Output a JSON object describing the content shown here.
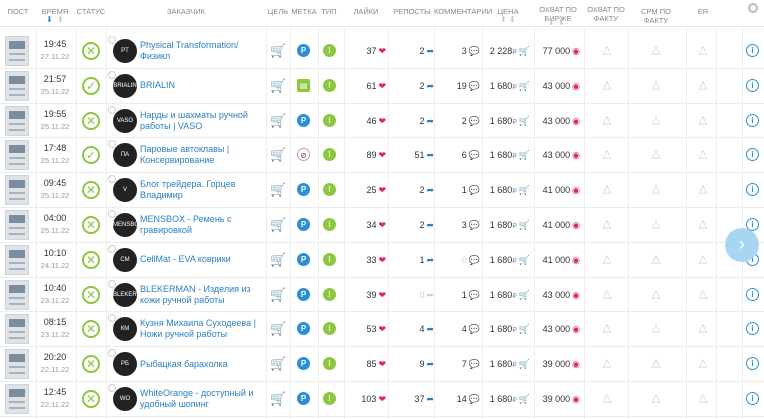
{
  "columns": {
    "post": "ПОСТ",
    "time": "ВРЕМЯ",
    "status": "СТАТУС",
    "channel": "ЗАКАЗЧИК",
    "goal": "ЦЕЛЬ",
    "mark": "МЕТКА",
    "type": "ТИП",
    "likes": "ЛАЙКИ",
    "reposts": "РЕПОСТЫ",
    "comments": "КОММЕНТАРИИ",
    "price": "ЦЕНА",
    "reach_exchange": "ОХВАТ ПО БИРЖЕ",
    "reach_fact": "ОХВАТ ПО ФАКТУ",
    "cpm_fact": "CPM ПО ФАКТУ",
    "er": "ER"
  },
  "rows": [
    {
      "time": "19:45",
      "date": "27.11.22",
      "status": "fail",
      "channel": "Physical Transformation/ Физикл",
      "mark": "p",
      "likes": "37",
      "reposts": "2",
      "comments": "3",
      "comments_faded": false,
      "reposts_faded": false,
      "price": "2 228",
      "reach": "77 000",
      "avatar": "PT"
    },
    {
      "time": "21:57",
      "date": "25.11.22",
      "status": "ok",
      "channel": "BRIALIN",
      "mark": "book",
      "likes": "61",
      "reposts": "2",
      "comments": "19",
      "comments_faded": false,
      "reposts_faded": false,
      "price": "1 680",
      "reach": "43 000",
      "avatar": "BRIALIN"
    },
    {
      "time": "19:55",
      "date": "25.11.22",
      "status": "fail",
      "channel": "Нарды и шахматы ручной работы | VASO",
      "mark": "p",
      "likes": "46",
      "reposts": "2",
      "comments": "2",
      "comments_faded": false,
      "reposts_faded": false,
      "price": "1 680",
      "reach": "43 000",
      "avatar": "VASO"
    },
    {
      "time": "17:48",
      "date": "25.11.22",
      "status": "ok",
      "channel": "Паровые автоклавы | Консервирование",
      "mark": "no",
      "likes": "89",
      "reposts": "51",
      "comments": "6",
      "comments_faded": false,
      "reposts_faded": false,
      "price": "1 680",
      "reach": "43 000",
      "avatar": "ПА"
    },
    {
      "time": "09:45",
      "date": "25.11.22",
      "status": "fail",
      "channel": "Блог трейдера. Горцев Владимир",
      "mark": "p",
      "likes": "25",
      "reposts": "2",
      "comments": "1",
      "comments_faded": false,
      "reposts_faded": false,
      "price": "1 680",
      "reach": "41 000",
      "avatar": "V"
    },
    {
      "time": "04:00",
      "date": "25.11.22",
      "status": "fail",
      "channel": "MENSBOX - Ремень с гравировкой",
      "mark": "p",
      "likes": "34",
      "reposts": "2",
      "comments": "3",
      "comments_faded": false,
      "reposts_faded": false,
      "price": "1 680",
      "reach": "41 000",
      "avatar": "MENSBOX"
    },
    {
      "time": "10:10",
      "date": "24.11.22",
      "status": "fail",
      "channel": "CellMat - EVA коврики",
      "mark": "p",
      "likes": "33",
      "reposts": "1",
      "comments": "0",
      "comments_faded": true,
      "reposts_faded": false,
      "price": "1 680",
      "reach": "41 000",
      "avatar": "CM"
    },
    {
      "time": "10:40",
      "date": "23.11.22",
      "status": "fail",
      "channel": "BLEKERMAN - Изделия из кожи ручной работы",
      "mark": "p",
      "likes": "39",
      "reposts": "0",
      "comments": "1",
      "comments_faded": false,
      "reposts_faded": true,
      "price": "1 680",
      "reach": "43 000",
      "avatar": "BLEKERMAN"
    },
    {
      "time": "08:15",
      "date": "23.11.22",
      "status": "fail",
      "channel": "Кузня Михаила Суходеева | Ножи ручной работы",
      "mark": "p",
      "likes": "53",
      "reposts": "4",
      "comments": "4",
      "comments_faded": false,
      "reposts_faded": false,
      "price": "1 680",
      "reach": "43 000",
      "avatar": "КМ"
    },
    {
      "time": "20:20",
      "date": "22.11.22",
      "status": "fail",
      "channel": "Рыбацкая барахолка",
      "mark": "p",
      "likes": "85",
      "reposts": "9",
      "comments": "7",
      "comments_faded": false,
      "reposts_faded": false,
      "price": "1 680",
      "reach": "39 000",
      "avatar": "РБ"
    },
    {
      "time": "12:45",
      "date": "22.11.22",
      "status": "fail",
      "channel": "WhiteOrange - доступный и удобный шопинг",
      "mark": "p",
      "likes": "103",
      "reposts": "37",
      "comments": "14",
      "comments_faded": false,
      "reposts_faded": false,
      "price": "1 680",
      "reach": "39 000",
      "avatar": "WO"
    }
  ],
  "colors": {
    "accent": "#2b8fd8",
    "ok": "#8dc63f",
    "fail": "#8dc63f",
    "link": "#2b7fc4",
    "heart": "#e0245e"
  },
  "icons": {
    "goal": "cart-icon",
    "type": "info-green-icon",
    "likes": "heart-icon",
    "reposts": "share-icon",
    "comments": "comment-icon",
    "price": "cart-pink-icon",
    "reach": "eye-icon",
    "fact": "triangle-icon",
    "row_info": "info-icon",
    "settings": "gear-icon",
    "next": "chevron-right-icon"
  },
  "symbols": {
    "ruble": "₽"
  }
}
